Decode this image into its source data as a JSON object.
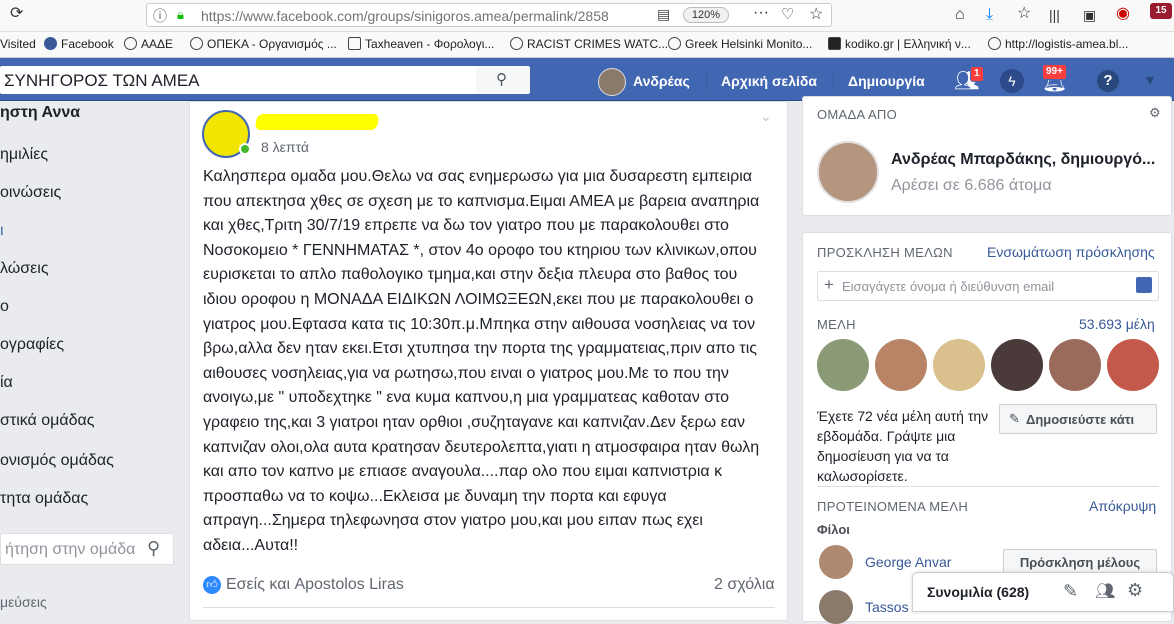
{
  "browser": {
    "url": "https://www.facebook.com/groups/sinigoros.amea/permalink/2858",
    "zoom": "120%",
    "downloads_badge": "15",
    "bookmarks": [
      "Visited",
      "Facebook",
      "ΑΑΔΕ",
      "ΟΠΕΚΑ - Οργανισμός ...",
      "Taxheaven - Φορολογι...",
      "RACIST CRIMES WATC...",
      "Greek Helsinki Monito...",
      "kodiko.gr | Ελληνική ν...",
      "http://logistis-amea.bl..."
    ]
  },
  "fb_header": {
    "search_value": "ΣΥΝΗΓΟΡΟΣ ΤΩΝ ΑΜΕΑ",
    "user_name": "Ανδρέας",
    "home": "Αρχική σελίδα",
    "create": "Δημιουργία",
    "friend_badge": "1",
    "notif_badge": "99+"
  },
  "left_nav": {
    "items": [
      "ηστη Αννα",
      "ημιλίες",
      "οινώσεις",
      "ι",
      "λώσεις",
      "ο",
      "ογραφίες",
      "ία",
      "στικά ομάδας",
      "ονισμός ομάδας",
      "τητα ομάδας"
    ],
    "search_placeholder": "ήτηση στην ομάδα",
    "bottom": "μεύσεις"
  },
  "post": {
    "time": "8 λεπτά",
    "body": "Καλησπερα ομαδα μου.Θελω να σας ενημερωσω για μια δυσαρεστη εμπειρια που απεκτησα χθες σε σχεση με το καπνισμα.Ειμαι ΑΜΕΑ με βαρεια αναπηρια και χθες,Τριτη 30/7/19 επρεπε να δω τον γιατρο που με παρακολουθει στο Νοσοκομειο * ΓΕΝΝΗΜΑΤΑΣ *, στον 4ο οροφο του κτηριου των κλινικων,οπου ευρισκεται το απλο παθολογικο τμημα,και στην δεξια πλευρα στο βαθος του ιδιου οροφου η ΜΟΝΑΔΑ ΕΙΔΙΚΩΝ ΛΟΙΜΩΞΕΩΝ,εκει που με παρακολουθει ο γιατρος μου.Εφτασα κατα τις 10:30π.μ.Μπηκα στην αιθουσα νοσηλειας να τον βρω,αλλα δεν ηταν εκει.Ετσι χτυπησα την πορτα της γραμματειας,πριν απο τις αιθουσες νοσηλειας,για να ρωτησω,που ειναι ο γιατρος μου.Με το που την ανοιγω,με \" υποδεχτηκε \" ενα κυμα καπνου,η μια γραμματεας καθοταν στο γραφειο της,και 3 γιατροι ηταν ορθιοι ,συζηταγανε και καπνιζαν.Δεν ξερω εαν καπνιζαν ολοι,ολα αυτα κρατησαν δευτερολεπτα,γιατι η ατμοσφαιρα ηταν θωλη και απο τον καπνο με επιασε αναγουλα....παρ ολο που ειμαι καπνιστρια κ προσπαθω να το κοψω...Εκλεισα με δυναμη την πορτα και εφυγα απραγη...Σημερα τηλεφωνησα στον γιατρο μου,και μου ειπαν πως εχει αδεια...Αυτα!!",
    "reactions": "Εσείς και Apostolos Liras",
    "comments": "2 σχόλια"
  },
  "right": {
    "group_by": "ΟΜΑΔΑ ΑΠΟ",
    "admin_name": "Ανδρέας Μπαρδάκης, δημιουργό...",
    "likes": "Αρέσει σε 6.686 άτομα",
    "invite_head": "ΠΡΟΣΚΛΗΣΗ ΜΕΛΩΝ",
    "invite_link": "Ενσωμάτωση πρόσκλησης",
    "invite_placeholder": "Εισαγάγετε όνομα ή διεύθυνση email",
    "members_head": "ΜΕΛΗ",
    "members_count": "53.693 μέλη",
    "new_members_text": "Έχετε 72 νέα μέλη αυτή την εβδομάδα. Γράψτε μια δημοσίευση για να τα καλωσορίσετε.",
    "post_button": "Δημοσιεύστε κάτι",
    "suggested_head": "ΠΡΟΤΕΙΝΟΜΕΝΑ ΜΕΛΗ",
    "hide": "Απόκρυψη",
    "friends": "Φίλοι",
    "suggested": [
      "George Anvar",
      "Tassos"
    ],
    "invite_button": "Πρόσκληση μέλους"
  },
  "chat": {
    "label": "Συνομιλία (628)"
  },
  "colors": {
    "fb_blue": "#4267b2",
    "link": "#385898",
    "badge_red": "#fa3e3e"
  }
}
